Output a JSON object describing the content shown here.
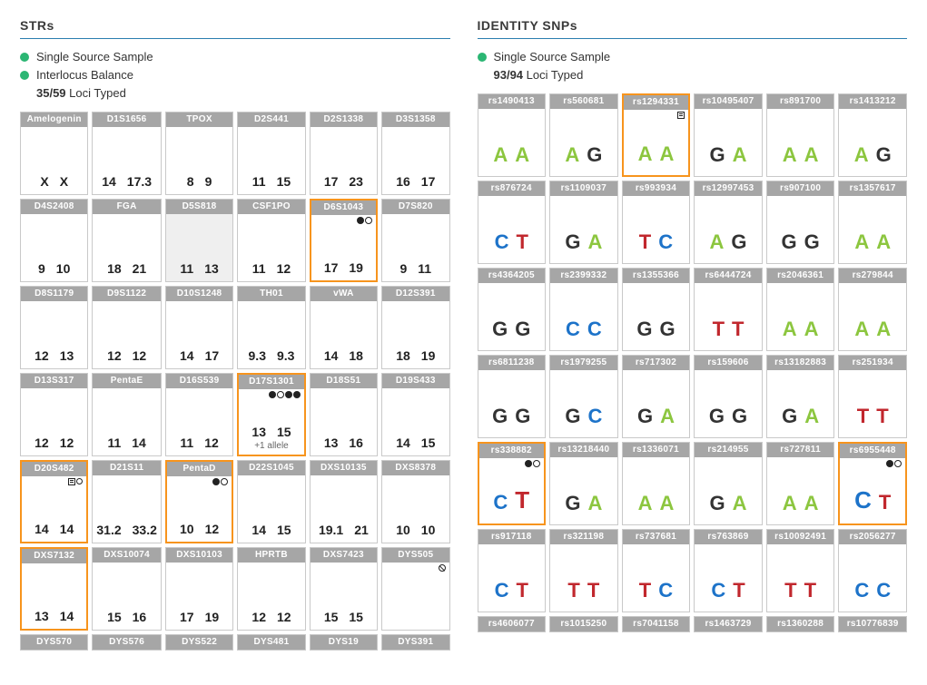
{
  "left": {
    "title": "STRs",
    "status": [
      {
        "dot": true,
        "text_html": "Single Source Sample"
      },
      {
        "dot": true,
        "text_html": "Interlocus Balance"
      },
      {
        "dot": false,
        "text_html": "<b>35/59</b> Loci Typed"
      }
    ],
    "rows": [
      {
        "cells": [
          {
            "name": "Amelogenin",
            "alleles": [
              "X",
              "X"
            ]
          },
          {
            "name": "D1S1656",
            "alleles": [
              "14",
              "17.3"
            ]
          },
          {
            "name": "TPOX",
            "alleles": [
              "8",
              "9"
            ]
          },
          {
            "name": "D2S441",
            "alleles": [
              "11",
              "15"
            ]
          },
          {
            "name": "D2S1338",
            "alleles": [
              "17",
              "23"
            ]
          },
          {
            "name": "D3S1358",
            "alleles": [
              "16",
              "17"
            ]
          }
        ]
      },
      {
        "cells": [
          {
            "name": "D4S2408",
            "alleles": [
              "9",
              "10"
            ]
          },
          {
            "name": "FGA",
            "alleles": [
              "18",
              "21"
            ]
          },
          {
            "name": "D5S818",
            "alleles": [
              "11",
              "13"
            ],
            "shaded": true
          },
          {
            "name": "CSF1PO",
            "alleles": [
              "11",
              "12"
            ]
          },
          {
            "name": "D6S1043",
            "alleles": [
              "17",
              "19"
            ],
            "flagged": true,
            "icons": [
              "dot-f",
              "dot-h"
            ]
          },
          {
            "name": "D7S820",
            "alleles": [
              "9",
              "11"
            ]
          }
        ]
      },
      {
        "cells": [
          {
            "name": "D8S1179",
            "alleles": [
              "12",
              "13"
            ]
          },
          {
            "name": "D9S1122",
            "alleles": [
              "12",
              "12"
            ]
          },
          {
            "name": "D10S1248",
            "alleles": [
              "14",
              "17"
            ]
          },
          {
            "name": "TH01",
            "alleles": [
              "9.3",
              "9.3"
            ]
          },
          {
            "name": "vWA",
            "alleles": [
              "14",
              "18"
            ]
          },
          {
            "name": "D12S391",
            "alleles": [
              "18",
              "19"
            ]
          }
        ]
      },
      {
        "cells": [
          {
            "name": "D13S317",
            "alleles": [
              "12",
              "12"
            ]
          },
          {
            "name": "PentaE",
            "alleles": [
              "11",
              "14"
            ]
          },
          {
            "name": "D16S539",
            "alleles": [
              "11",
              "12"
            ]
          },
          {
            "name": "D17S1301",
            "alleles": [
              "13",
              "15"
            ],
            "flagged": true,
            "extra": "+1 allele",
            "icons": [
              "dot-f",
              "dot-h",
              "dot-f",
              "dot-f"
            ]
          },
          {
            "name": "D18S51",
            "alleles": [
              "13",
              "16"
            ]
          },
          {
            "name": "D19S433",
            "alleles": [
              "14",
              "15"
            ]
          }
        ]
      },
      {
        "cells": [
          {
            "name": "D20S482",
            "alleles": [
              "14",
              "14"
            ],
            "flagged": true,
            "icons": [
              "sq-h",
              "circ-sm"
            ]
          },
          {
            "name": "D21S11",
            "alleles": [
              "31.2",
              "33.2"
            ]
          },
          {
            "name": "PentaD",
            "alleles": [
              "10",
              "12"
            ],
            "flagged": true,
            "icons": [
              "dot-f",
              "dot-h"
            ]
          },
          {
            "name": "D22S1045",
            "alleles": [
              "14",
              "15"
            ]
          },
          {
            "name": "DXS10135",
            "alleles": [
              "19.1",
              "21"
            ]
          },
          {
            "name": "DXS8378",
            "alleles": [
              "10",
              "10"
            ]
          }
        ]
      },
      {
        "cells": [
          {
            "name": "DXS7132",
            "alleles": [
              "13",
              "14"
            ],
            "flagged": true
          },
          {
            "name": "DXS10074",
            "alleles": [
              "15",
              "16"
            ]
          },
          {
            "name": "DXS10103",
            "alleles": [
              "17",
              "19"
            ]
          },
          {
            "name": "HPRTB",
            "alleles": [
              "12",
              "12"
            ]
          },
          {
            "name": "DXS7423",
            "alleles": [
              "15",
              "15"
            ]
          },
          {
            "name": "DYS505",
            "alleles": [],
            "icons": [
              "cancel"
            ]
          }
        ]
      },
      {
        "truncated": true,
        "cells": [
          {
            "name": "DYS570"
          },
          {
            "name": "DYS576"
          },
          {
            "name": "DYS522"
          },
          {
            "name": "DYS481"
          },
          {
            "name": "DYS19"
          },
          {
            "name": "DYS391"
          }
        ]
      }
    ]
  },
  "right": {
    "title": "IDENTITY SNPs",
    "status": [
      {
        "dot": true,
        "text_html": "Single Source Sample"
      },
      {
        "dot": false,
        "text_html": "<b>93/94</b> Loci Typed"
      }
    ],
    "rows": [
      {
        "cells": [
          {
            "name": "rs1490413",
            "alleles": [
              "A",
              "A"
            ]
          },
          {
            "name": "rs560681",
            "alleles": [
              "A",
              "G"
            ]
          },
          {
            "name": "rs1294331",
            "alleles": [
              "A",
              "A"
            ],
            "flagged": true,
            "icons": [
              "sq-h"
            ]
          },
          {
            "name": "rs10495407",
            "alleles": [
              "G",
              "A"
            ]
          },
          {
            "name": "rs891700",
            "alleles": [
              "A",
              "A"
            ]
          },
          {
            "name": "rs1413212",
            "alleles": [
              "A",
              "G"
            ]
          }
        ]
      },
      {
        "cells": [
          {
            "name": "rs876724",
            "alleles": [
              "C",
              "T"
            ]
          },
          {
            "name": "rs1109037",
            "alleles": [
              "G",
              "A"
            ]
          },
          {
            "name": "rs993934",
            "alleles": [
              "T",
              "C"
            ]
          },
          {
            "name": "rs12997453",
            "alleles": [
              "A",
              "G"
            ]
          },
          {
            "name": "rs907100",
            "alleles": [
              "G",
              "G"
            ]
          },
          {
            "name": "rs1357617",
            "alleles": [
              "A",
              "A"
            ]
          }
        ]
      },
      {
        "cells": [
          {
            "name": "rs4364205",
            "alleles": [
              "G",
              "G"
            ]
          },
          {
            "name": "rs2399332",
            "alleles": [
              "C",
              "C"
            ]
          },
          {
            "name": "rs1355366",
            "alleles": [
              "G",
              "G"
            ]
          },
          {
            "name": "rs6444724",
            "alleles": [
              "T",
              "T"
            ]
          },
          {
            "name": "rs2046361",
            "alleles": [
              "A",
              "A"
            ]
          },
          {
            "name": "rs279844",
            "alleles": [
              "A",
              "A"
            ]
          }
        ]
      },
      {
        "cells": [
          {
            "name": "rs6811238",
            "alleles": [
              "G",
              "G"
            ]
          },
          {
            "name": "rs1979255",
            "alleles": [
              "G",
              "C"
            ]
          },
          {
            "name": "rs717302",
            "alleles": [
              "G",
              "A"
            ]
          },
          {
            "name": "rs159606",
            "alleles": [
              "G",
              "G"
            ]
          },
          {
            "name": "rs13182883",
            "alleles": [
              "G",
              "A"
            ]
          },
          {
            "name": "rs251934",
            "alleles": [
              "T",
              "T"
            ]
          }
        ]
      },
      {
        "cells": [
          {
            "name": "rs338882",
            "alleles": [
              "C",
              "T"
            ],
            "big1": true,
            "flagged": true,
            "icons": [
              "dot-f",
              "dot-h"
            ]
          },
          {
            "name": "rs13218440",
            "alleles": [
              "G",
              "A"
            ]
          },
          {
            "name": "rs1336071",
            "alleles": [
              "A",
              "A"
            ]
          },
          {
            "name": "rs214955",
            "alleles": [
              "G",
              "A"
            ]
          },
          {
            "name": "rs727811",
            "alleles": [
              "A",
              "A"
            ]
          },
          {
            "name": "rs6955448",
            "alleles": [
              "C",
              "T"
            ],
            "big0": true,
            "flagged": true,
            "icons": [
              "dot-f",
              "dot-h"
            ]
          }
        ]
      },
      {
        "cells": [
          {
            "name": "rs917118",
            "alleles": [
              "C",
              "T"
            ]
          },
          {
            "name": "rs321198",
            "alleles": [
              "T",
              "T"
            ]
          },
          {
            "name": "rs737681",
            "alleles": [
              "T",
              "C"
            ]
          },
          {
            "name": "rs763869",
            "alleles": [
              "C",
              "T"
            ]
          },
          {
            "name": "rs10092491",
            "alleles": [
              "T",
              "T"
            ]
          },
          {
            "name": "rs2056277",
            "alleles": [
              "C",
              "C"
            ]
          }
        ]
      },
      {
        "truncated": true,
        "cells": [
          {
            "name": "rs4606077"
          },
          {
            "name": "rs1015250"
          },
          {
            "name": "rs7041158"
          },
          {
            "name": "rs1463729"
          },
          {
            "name": "rs1360288"
          },
          {
            "name": "rs10776839"
          }
        ]
      }
    ]
  }
}
